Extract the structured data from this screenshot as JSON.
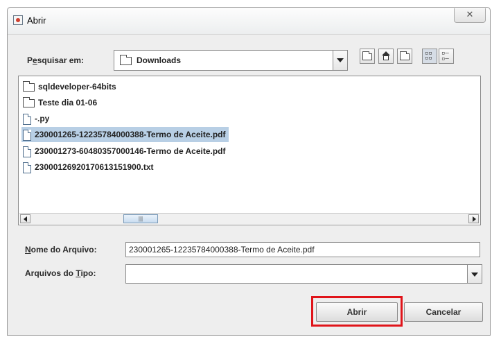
{
  "window": {
    "title": "Abrir",
    "close_label": "⌦"
  },
  "lookin": {
    "label_prefix": "P",
    "label_u": "e",
    "label_rest": "squisar em:",
    "value": "Downloads"
  },
  "files": [
    {
      "name": "sqldeveloper-64bits",
      "type": "folder"
    },
    {
      "name": "Teste dia 01-06",
      "type": "folder"
    },
    {
      "name": "-.py",
      "type": "file"
    },
    {
      "name": "230001265-12235784000388-Termo de Aceite.pdf",
      "type": "file",
      "selected": true
    },
    {
      "name": "230001273-60480357000146-Termo de Aceite.pdf",
      "type": "file"
    },
    {
      "name": "23000126920170613151900.txt",
      "type": "file"
    }
  ],
  "scroll_thumb_glyph": "|||",
  "filename": {
    "label_u": "N",
    "label_rest": "ome do Arquivo:",
    "value": "230001265-12235784000388-Termo de Aceite.pdf"
  },
  "filetype": {
    "label_prefix": "Arquivos do ",
    "label_u": "T",
    "label_rest": "ipo:",
    "value": ""
  },
  "buttons": {
    "open": "Abrir",
    "cancel": "Cancelar"
  },
  "highlight_color": "#e0141a"
}
